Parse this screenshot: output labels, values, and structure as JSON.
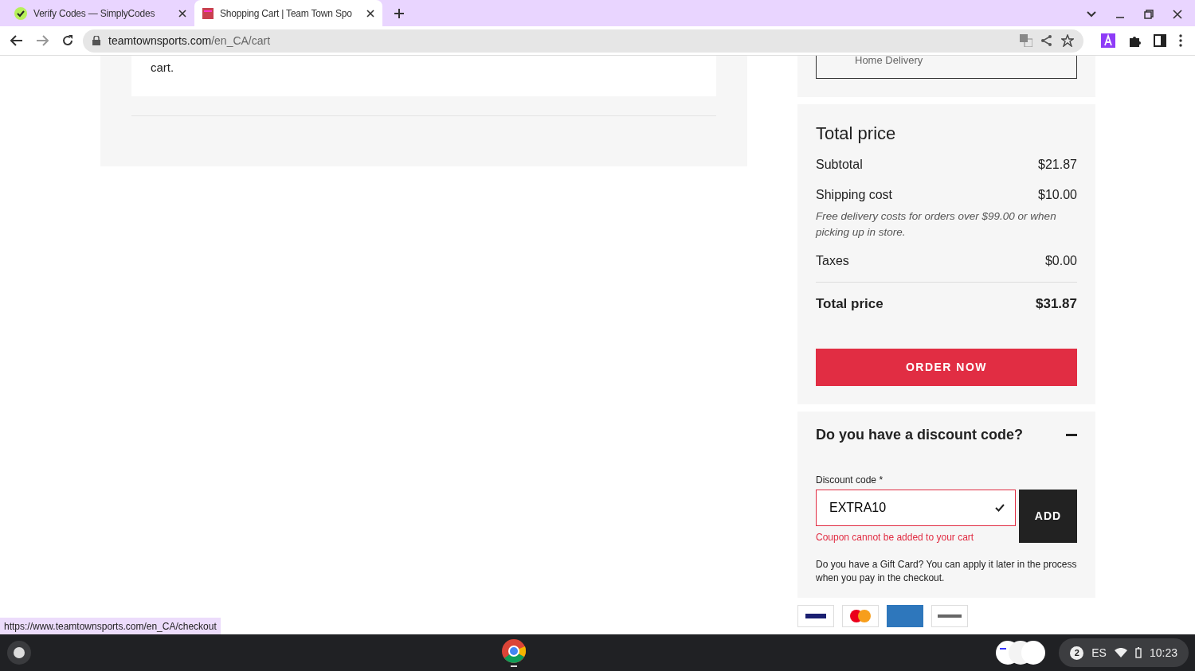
{
  "browser": {
    "tabs": [
      {
        "title": "Verify Codes — SimplyCodes",
        "selected": false
      },
      {
        "title": "Shopping Cart | Team Town Spo",
        "selected": true
      }
    ],
    "address": {
      "domain": "teamtownsports.com",
      "path": "/en_CA/cart"
    }
  },
  "cart_note": "cart.",
  "delivery_option": "Home Delivery",
  "total": {
    "title": "Total price",
    "rows": [
      {
        "label": "Subtotal",
        "value": "$21.87"
      },
      {
        "label": "Shipping cost",
        "value": "$10.00",
        "note": "Free delivery costs for orders over $99.00 or when picking up in store."
      },
      {
        "label": "Taxes",
        "value": "$0.00"
      }
    ],
    "total_label": "Total price",
    "total_value": "$31.87",
    "order_button": "ORDER NOW"
  },
  "discount": {
    "title": "Do you have a discount code?",
    "expanded": true,
    "label": "Discount code *",
    "value": "EXTRA10",
    "error": "Coupon cannot be added to your cart",
    "button": "ADD",
    "gift_note": "Do you have a Gift Card? You can apply it later in the process when you pay in the checkout."
  },
  "status_url": "https://www.teamtownsports.com/en_CA/checkout",
  "taskbar": {
    "notifications": "2",
    "language": "ES",
    "time": "10:23"
  }
}
